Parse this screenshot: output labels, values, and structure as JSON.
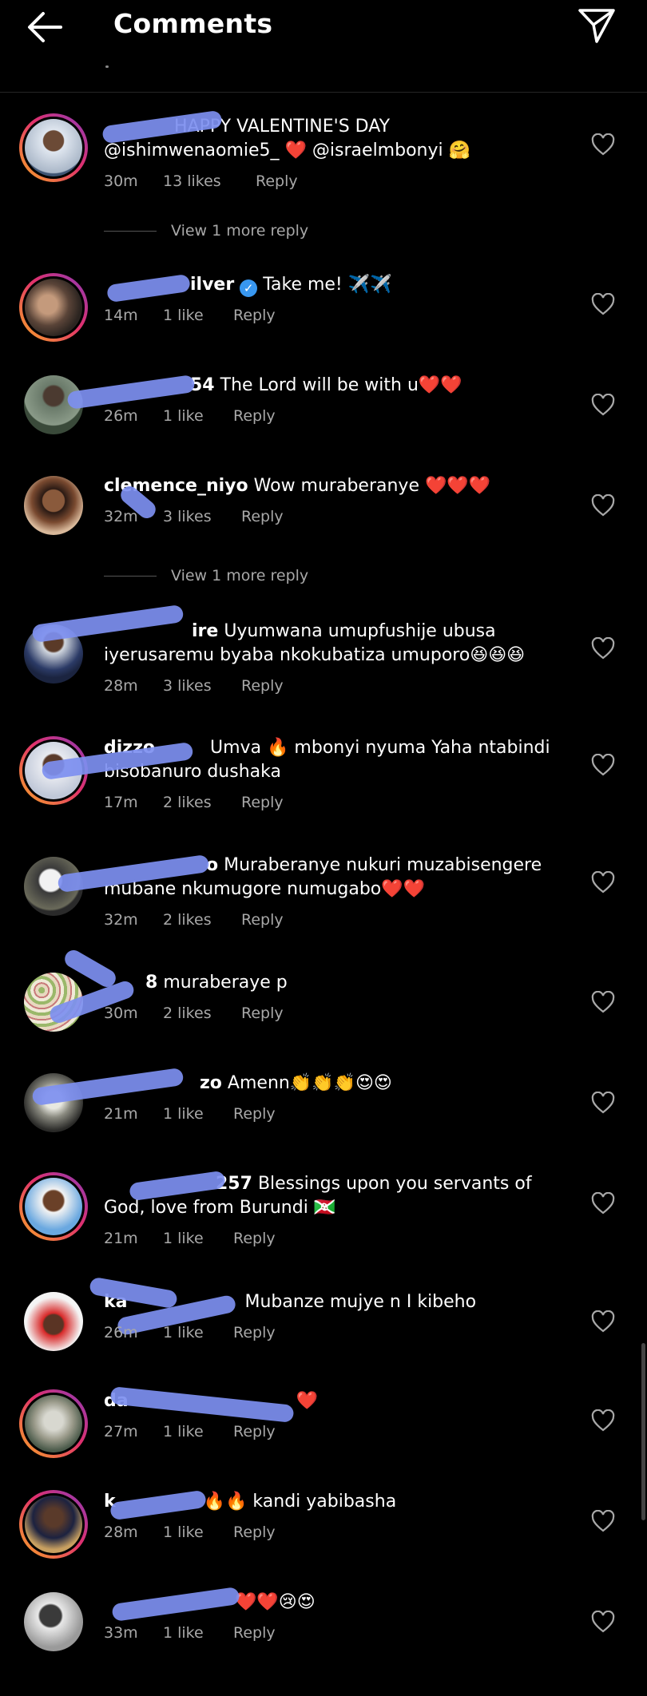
{
  "header": {
    "title": "Comments",
    "back_icon": "back-arrow-icon",
    "send_icon": "send-icon"
  },
  "colors": {
    "background": "#000000",
    "secondary_text": "#a8a8a8",
    "verified": "#3897f0",
    "redaction": "#7d8ff0"
  },
  "comments": [
    {
      "user": "",
      "text": "HAPPY VALENTINE'S DAY @ishimwenaomie5_ ❤️ @israelmbonyi 🤗",
      "time": "30m",
      "likes": "13 likes",
      "reply": "Reply",
      "view_more": "View 1 more reply"
    },
    {
      "user": "ilver",
      "verified": true,
      "text": "Take me! ✈️✈️",
      "time": "14m",
      "likes": "1 like",
      "reply": "Reply"
    },
    {
      "user": "54",
      "text": "The Lord will be with u❤️❤️",
      "time": "26m",
      "likes": "1 like",
      "reply": "Reply"
    },
    {
      "user": "clemence_niyo",
      "text": "Wow muraberanye ❤️❤️❤️",
      "time": "32m",
      "likes": "3 likes",
      "reply": "Reply",
      "view_more": "View 1 more reply"
    },
    {
      "user": "ire",
      "text": "Uyumwana umupfushije  ubusa iyerusaremu  byaba nkokubatiza umuporo😆😆😆",
      "time": "28m",
      "likes": "3 likes",
      "reply": "Reply"
    },
    {
      "user": "dizzo",
      "text": "Umva 🔥 mbonyi nyuma Yaha ntabindi bisobanuro dushaka",
      "time": "17m",
      "likes": "2 likes",
      "reply": "Reply"
    },
    {
      "user": "o",
      "text": "Muraberanye nukuri muzabisengere mubane nkumugore numugabo❤️❤️",
      "time": "32m",
      "likes": "2 likes",
      "reply": "Reply"
    },
    {
      "user": "8",
      "text": "muraberaye p",
      "time": "30m",
      "likes": "2 likes",
      "reply": "Reply"
    },
    {
      "user": "zo",
      "text": "Amenn👏👏👏😍😍",
      "time": "21m",
      "likes": "1 like",
      "reply": "Reply"
    },
    {
      "user": "257",
      "text": "Blessings upon you servants of God, love from Burundi 🇧🇮",
      "time": "21m",
      "likes": "1 like",
      "reply": "Reply"
    },
    {
      "user": "ka",
      "text": "Mubanze mujye n I kibeho",
      "time": "26m",
      "likes": "1 like",
      "reply": "Reply"
    },
    {
      "user": "da",
      "text": "❤️",
      "time": "27m",
      "likes": "1 like",
      "reply": "Reply"
    },
    {
      "user": "k",
      "text": "🔥🔥 kandi yabibasha",
      "time": "28m",
      "likes": "1 like",
      "reply": "Reply"
    },
    {
      "user": "",
      "text": "❤️❤️😢😍",
      "time": "33m",
      "likes": "1 like",
      "reply": "Reply"
    }
  ]
}
